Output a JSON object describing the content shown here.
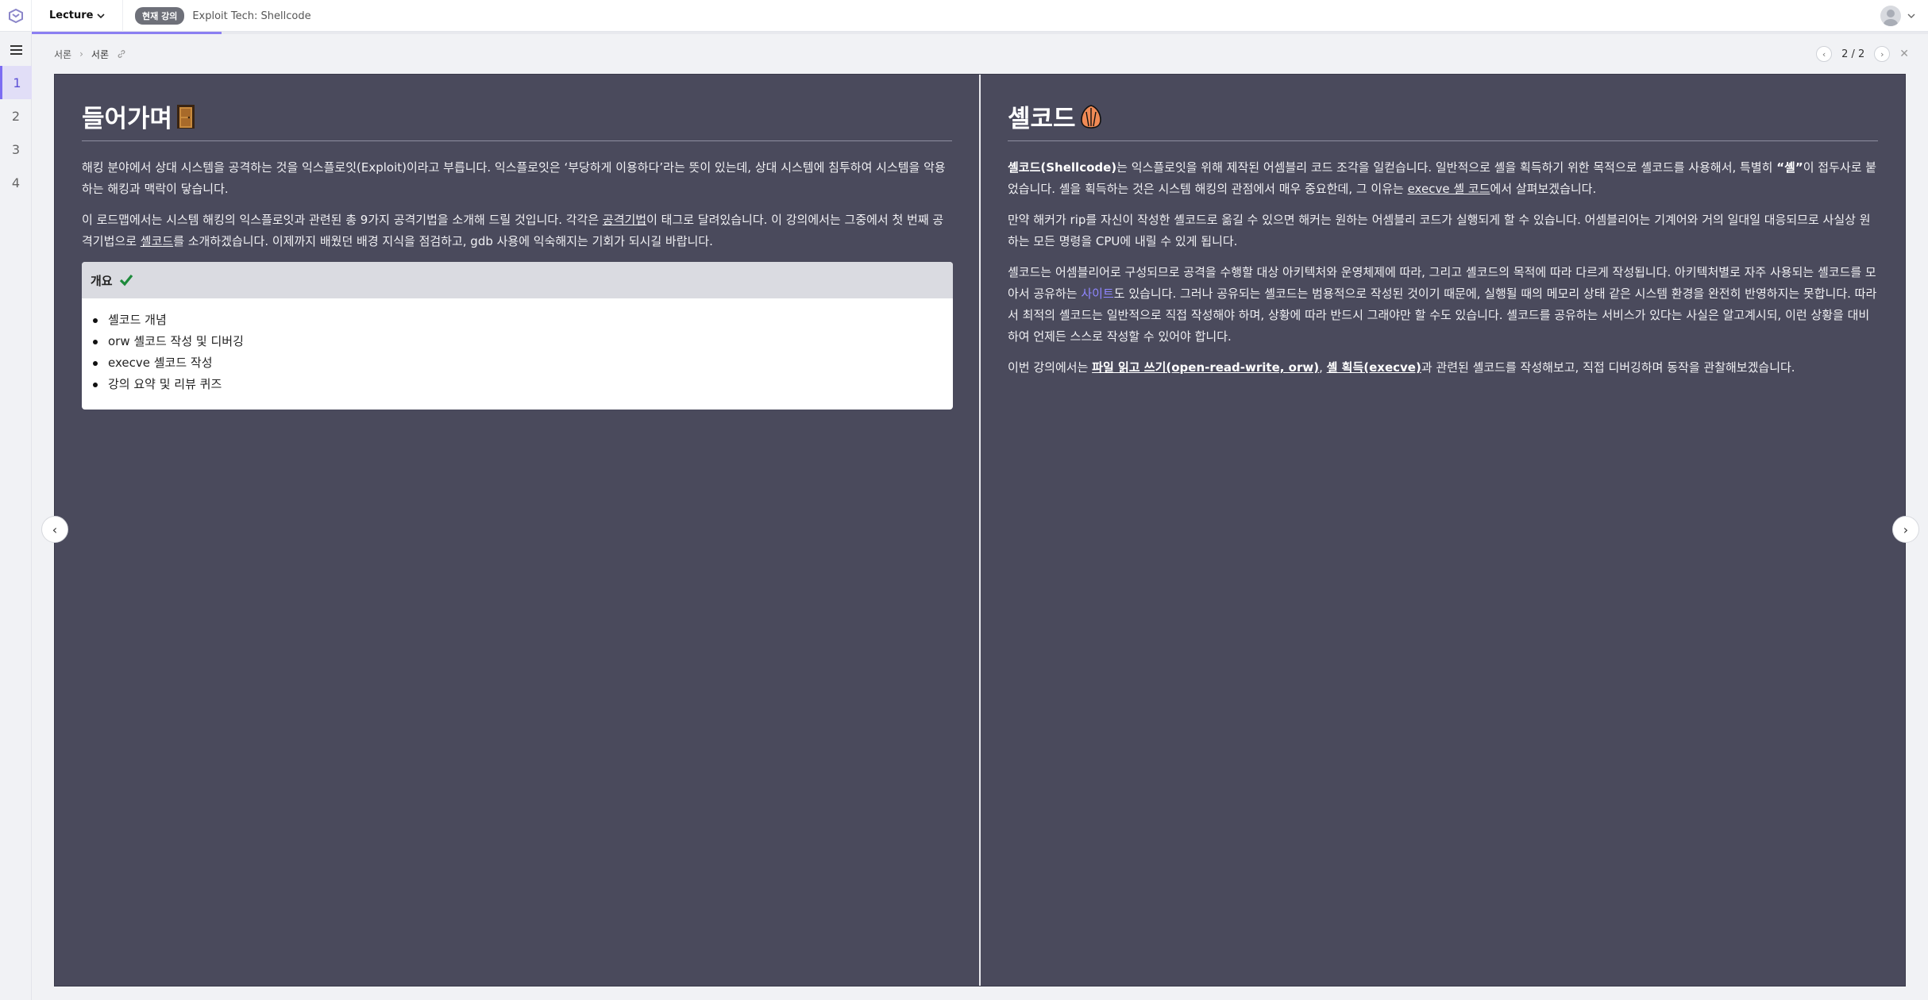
{
  "header": {
    "lecture_menu": "Lecture",
    "current_badge": "현재 강의",
    "course_title": "Exploit Tech: Shellcode",
    "progress": 0.1
  },
  "rail": {
    "slides": [
      "1",
      "2",
      "3",
      "4"
    ],
    "active_index": 0
  },
  "breadcrumb": {
    "parent": "서론",
    "current": "서론"
  },
  "pager": {
    "text": "2 / 2"
  },
  "left": {
    "title": "들어가며",
    "title_icon": "door-icon",
    "p1": "해킹 분야에서 상대 시스템을 공격하는 것을 익스플로잇(Exploit)이라고 부릅니다. 익스플로잇은 ‘부당하게 이용하다’라는 뜻이 있는데, 상대 시스템에 침투하여 시스템을 악용하는 해킹과 맥락이 닿습니다.",
    "p2_a": "이 로드맵에서는 시스템 해킹의 익스플로잇과 관련된 총 9가지 공격기법을 소개해 드릴 것입니다. 각각은 ",
    "p2_link1": "공격기법",
    "p2_b": "이 태그로 달려있습니다. 이 강의에서는 그중에서 첫 번째 공격기법으로 ",
    "p2_link2": "셸코드",
    "p2_c": "를 소개하겠습니다. 이제까지 배웠던 배경 지식을 점검하고, gdb 사용에 익숙해지는 기회가 되시길 바랍니다.",
    "overview_title": "개요",
    "overview_items": [
      "셸코드 개념",
      "orw 셸코드 작성 및 디버깅",
      "execve 셸코드 작성",
      "강의 요약 및 리뷰 퀴즈"
    ]
  },
  "right": {
    "title": "셸코드",
    "title_icon": "shell-icon",
    "p1_bold": "셸코드(Shellcode)",
    "p1_a": "는 익스플로잇을 위해 제작된 어셈블리 코드 조각을 일컫습니다. 일반적으로 셸을 획득하기 위한 목적으로 셸코드를 사용해서, 특별히 ",
    "p1_bold2": "“셸”",
    "p1_b": "이 접두사로 붙었습니다. 셸을 획득하는 것은 시스템 해킹의 관점에서 매우 중요한데, 그 이유는 ",
    "p1_link": "execve 셸 코드",
    "p1_c": "에서 살펴보겠습니다.",
    "p2": "만약 해커가 rip를 자신이 작성한 셸코드로 옮길 수 있으면 해커는 원하는 어셈블리 코드가 실행되게 할 수 있습니다. 어셈블리어는 기계어와 거의 일대일 대응되므로 사실상 원하는 모든 명령을 CPU에 내릴 수 있게 됩니다.",
    "p3_a": "셸코드는 어셈블리어로 구성되므로 공격을 수행할 대상 아키텍처와 운영체제에 따라, 그리고 셸코드의 목적에 따라 다르게 작성됩니다. 아키텍처별로 자주 사용되는 셸코드를 모아서 공유하는 ",
    "p3_link": "사이트",
    "p3_b": "도 있습니다. 그러나 공유되는 셸코드는 범용적으로 작성된 것이기 때문에, 실행될 때의 메모리 상태 같은 시스템 환경을 완전히 반영하지는 못합니다. 따라서 최적의 셸코드는 일반적으로 직접 작성해야 하며, 상황에 따라 반드시 그래야만 할 수도 있습니다. 셸코드를 공유하는 서비스가 있다는 사실은 알고계시되, 이런 상황을 대비하여 언제든 스스로 작성할 수 있어야 합니다.",
    "p4_a": "이번 강의에서는 ",
    "p4_link1": "파일 읽고 쓰기(open-read-write, orw)",
    "p4_sep": ", ",
    "p4_link2": "셸 획득(execve)",
    "p4_b": "과 관련된 셸코드를 작성해보고, 직접 디버깅하며 동작을 관찰해보겠습니다."
  },
  "colors": {
    "slide_bg": "#4a4a5c",
    "accent": "#7c6cf2",
    "link": "#8f86ff"
  }
}
